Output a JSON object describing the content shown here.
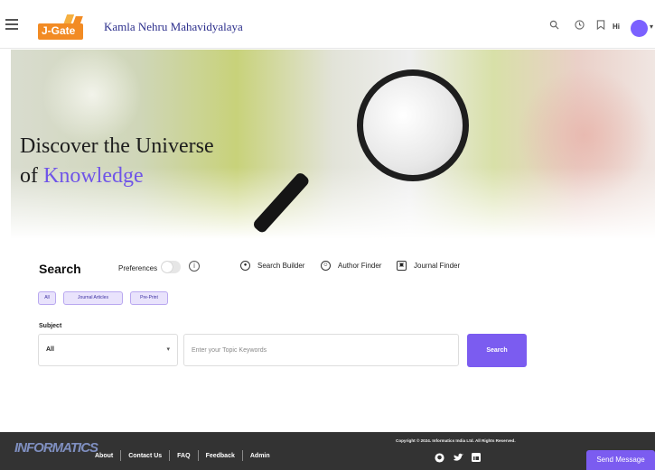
{
  "header": {
    "logo_text": "J-Gate",
    "institution": "Kamla Nehru Mahavidyalaya",
    "icons": [
      "menu-icon",
      "search-icon",
      "history-icon",
      "bookmark-icon",
      "user-avatar"
    ],
    "greeting": "Hi",
    "accent_color": "#7b5cf0"
  },
  "hero": {
    "title_line1": "Discover the Universe",
    "title_of": "of",
    "title_accent": "Knowledge"
  },
  "search": {
    "title": "Search",
    "preferences_label": "Preferences",
    "tools": [
      {
        "label": "Search Builder",
        "icon": "search-builder-icon"
      },
      {
        "label": "Author Finder",
        "icon": "author-finder-icon"
      },
      {
        "label": "Journal Finder",
        "icon": "journal-finder-icon"
      }
    ],
    "filters": [
      "All",
      "Journal Articles",
      "Pre-Print"
    ],
    "subject_label": "Subject",
    "subject_value": "All",
    "keyword_placeholder": "Enter your Topic Keywords",
    "button_label": "Search"
  },
  "footer": {
    "logo_text": "INFORMATICS",
    "links": [
      "About",
      "Contact Us",
      "FAQ",
      "Feedback",
      "Admin"
    ],
    "copyright": "Copyright © 2024. Informatics India Ltd. All Rights Reserved.",
    "social_icons": [
      "github-icon",
      "twitter-icon",
      "linkedin-icon"
    ],
    "send_message": "Send Message"
  }
}
